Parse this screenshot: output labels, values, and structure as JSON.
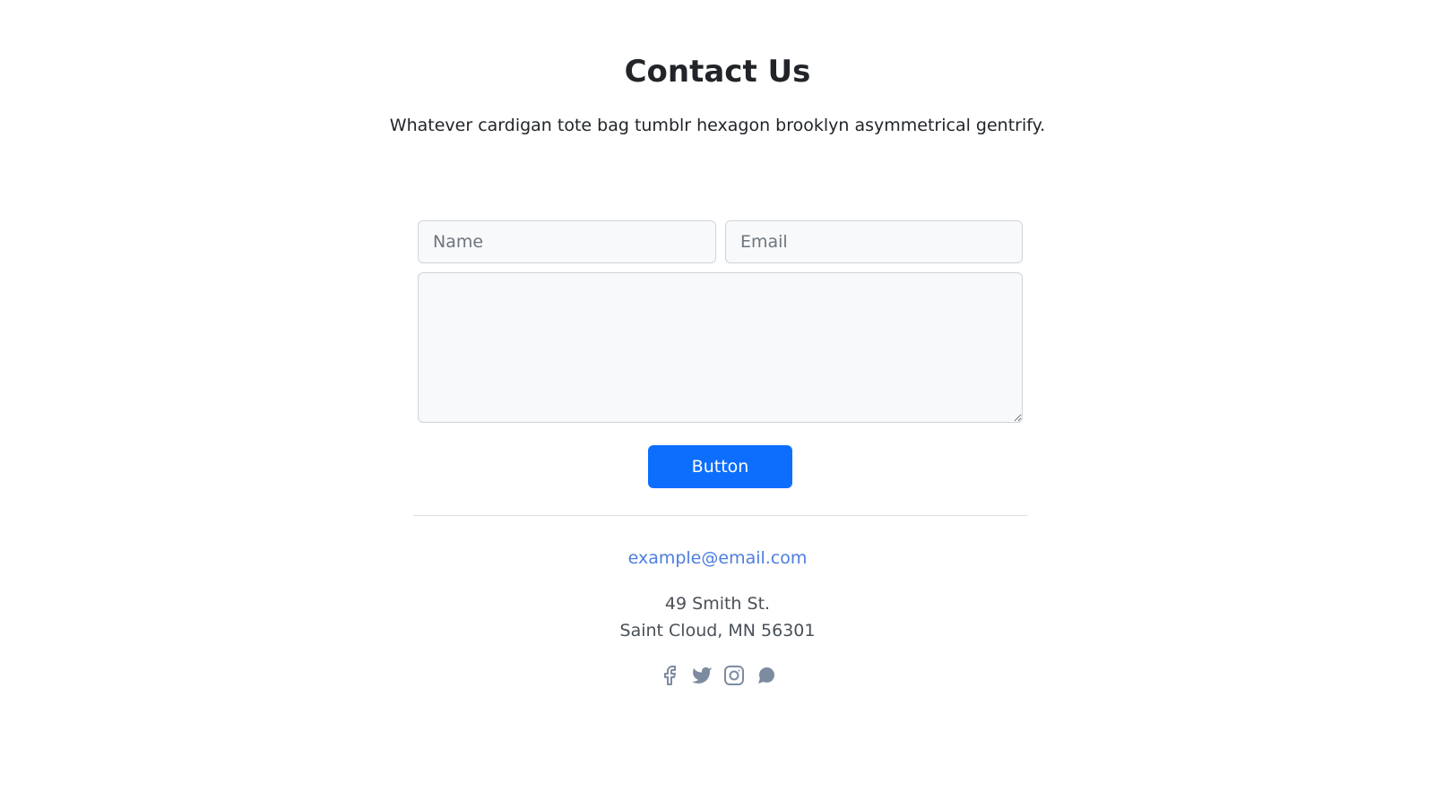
{
  "header": {
    "title": "Contact Us",
    "description": "Whatever cardigan tote bag tumblr hexagon brooklyn asymmetrical gentrify."
  },
  "form": {
    "name_placeholder": "Name",
    "name_value": "",
    "email_placeholder": "Email",
    "email_value": "",
    "message_value": "",
    "submit_label": "Button"
  },
  "footer": {
    "email": "example@email.com",
    "address_line1": "49 Smith St.",
    "address_line2": "Saint Cloud, MN 56301",
    "social_icons": [
      "facebook-icon",
      "twitter-icon",
      "instagram-icon",
      "chat-icon"
    ]
  },
  "colors": {
    "primary_button": "#0d6efd",
    "link": "#4c7de0",
    "icon": "#7d8ba1",
    "field_background": "#f8f9fa",
    "field_border": "#ced4da"
  }
}
